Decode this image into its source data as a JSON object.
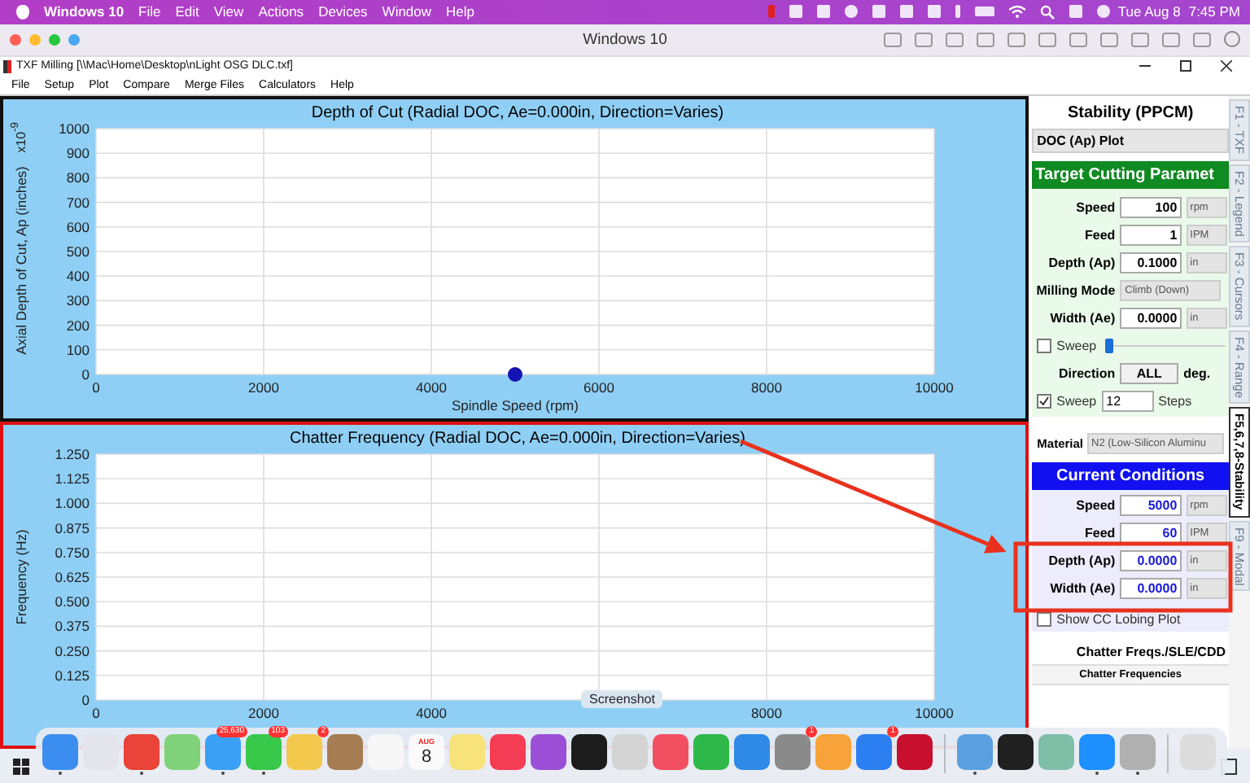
{
  "mac_menubar": {
    "app": "Windows 10",
    "menus": [
      "File",
      "Edit",
      "View",
      "Actions",
      "Devices",
      "Window",
      "Help"
    ],
    "date": "Tue Aug 8",
    "time": "7:45 PM"
  },
  "vm_window": {
    "title": "Windows 10"
  },
  "app_window": {
    "title": "TXF Milling [\\\\Mac\\Home\\Desktop\\nLight OSG DLC.txf]",
    "menus": [
      "File",
      "Setup",
      "Plot",
      "Compare",
      "Merge Files",
      "Calculators",
      "Help"
    ]
  },
  "plots": [
    {
      "selected": false,
      "scale_label": "x10$^{-9}$",
      "chart_data": {
        "grid": true,
        "type": "scatter",
        "title": "Depth of Cut (Radial DOC, Ae=0.000in, Direction=Varies)",
        "xlabel": "Spindle Speed (rpm)",
        "ylabel": "Axial Depth of Cut, Ap (inches)",
        "x": [
          5000
        ],
        "values": [
          0
        ],
        "xlim": [
          0,
          10000
        ],
        "ylim": [
          0,
          1000
        ],
        "xticks": [
          0,
          2000,
          4000,
          6000,
          8000,
          10000
        ],
        "yticks": [
          0,
          100,
          200,
          300,
          400,
          500,
          600,
          700,
          800,
          900,
          1000
        ]
      }
    },
    {
      "selected": true,
      "chart_data": {
        "grid": true,
        "type": "line",
        "title": "Chatter Frequency (Radial DOC, Ae=0.000in, Direction=Varies)",
        "ylabel": "Frequency (Hz)",
        "xlim": [
          0,
          10000
        ],
        "ylim": [
          0,
          1.25
        ],
        "xticks": [
          0,
          2000,
          4000,
          8000,
          10000
        ],
        "yticks": [
          {
            "value": 0,
            "label": "0"
          },
          {
            "value": 0.125,
            "label": "0.125"
          },
          {
            "value": 0.25,
            "label": "0.250"
          },
          {
            "value": 0.375,
            "label": "0.375"
          },
          {
            "value": 0.5,
            "label": "0.500"
          },
          {
            "value": 0.625,
            "label": "0.625"
          },
          {
            "value": 0.75,
            "label": "0.750"
          },
          {
            "value": 0.875,
            "label": "0.875"
          },
          {
            "value": 1,
            "label": "1.000"
          },
          {
            "value": 1.125,
            "label": "1.125"
          },
          {
            "value": 1.25,
            "label": "1.250"
          }
        ]
      }
    }
  ],
  "panel": {
    "title": "Stability (PPCM)",
    "plot_select": "DOC (Ap) Plot",
    "target": {
      "header": "Target Cutting Paramet",
      "rows": [
        {
          "kind": "field",
          "label": "Speed",
          "value": "100",
          "unit": "rpm"
        },
        {
          "kind": "field",
          "label": "Feed",
          "value": "1",
          "unit": "IPM"
        },
        {
          "kind": "field",
          "label": "Depth (Ap)",
          "value": "0.1000",
          "unit": "in"
        },
        {
          "kind": "select",
          "label": "Milling Mode",
          "value": "Climb (Down)"
        },
        {
          "kind": "field",
          "label": "Width (Ae)",
          "value": "0.0000",
          "unit": "in"
        },
        {
          "kind": "slider",
          "label": "Sweep",
          "checked": false,
          "level": 0
        },
        {
          "kind": "button",
          "label": "Direction",
          "value": "ALL",
          "unit": "deg."
        },
        {
          "kind": "steps",
          "label": "Sweep",
          "checked": true,
          "value": "12",
          "unit": "Steps"
        }
      ]
    },
    "material": {
      "label": "Material",
      "value": "N2 (Low-Silicon Aluminu"
    },
    "current": {
      "header": "Current Conditions",
      "rows": [
        {
          "kind": "field",
          "label": "Speed",
          "value": "5000",
          "unit": "rpm"
        },
        {
          "kind": "field",
          "label": "Feed",
          "value": "60",
          "unit": "IPM"
        },
        {
          "kind": "field",
          "label": "Depth (Ap)",
          "value": "0.0000",
          "unit": "in"
        },
        {
          "kind": "field",
          "label": "Width (Ae)",
          "value": "0.0000",
          "unit": "in"
        }
      ],
      "lobing": {
        "label": "Show CC Lobing Plot",
        "checked": false
      }
    },
    "chatter": {
      "title": "Chatter Freqs./SLE/CDD",
      "column": "Chatter Frequencies"
    }
  },
  "side_tabs": [
    {
      "label": "F1 - TXF",
      "selected": false
    },
    {
      "label": "F2 - Legend",
      "selected": false
    },
    {
      "label": "F3 - Cursors",
      "selected": false
    },
    {
      "label": "F4 - Range",
      "selected": false
    },
    {
      "label": "F5,6,7,8-Stability",
      "selected": true
    },
    {
      "label": "F9 - Modal",
      "selected": false
    }
  ],
  "tooltip": "Screenshot",
  "dock": {
    "groups": [
      [
        {
          "color": "#3b8ef0",
          "running": true
        },
        {
          "color": "#e4e4ec",
          "running": false
        },
        {
          "color": "#e9433a",
          "running": true
        },
        {
          "color": "#7fd27a",
          "running": false
        },
        {
          "color": "#3aa0f5",
          "running": true,
          "badge": "25,630"
        },
        {
          "color": "#38c84a",
          "running": true,
          "badge": "103"
        },
        {
          "color": "#f2c94c",
          "running": false,
          "badge": "2"
        },
        {
          "color": "#a67c52",
          "running": false
        },
        {
          "color": "#f7f7f7",
          "running": false
        },
        {
          "color": "#fafafa",
          "running": false,
          "month": "AUG",
          "day": "8"
        },
        {
          "color": "#f8e27a",
          "running": false
        },
        {
          "color": "#f43c54",
          "running": false
        },
        {
          "color": "#9a4fd6",
          "running": false
        },
        {
          "color": "#1c1c1c",
          "running": false
        },
        {
          "color": "#d4d4d4",
          "running": false
        },
        {
          "color": "#f25060",
          "running": false
        },
        {
          "color": "#2fb84a",
          "running": false
        },
        {
          "color": "#2e8ae6",
          "running": false
        },
        {
          "color": "#8a8a8a",
          "running": false,
          "badge": "1"
        },
        {
          "color": "#f7a33a",
          "running": false
        },
        {
          "color": "#2b7ff0",
          "running": false,
          "badge": "1"
        },
        {
          "color": "#c8102e",
          "running": false
        }
      ],
      [
        {
          "color": "#5aa0e0",
          "running": true
        },
        {
          "color": "#202020",
          "running": false
        },
        {
          "color": "#7fbfa8",
          "running": false
        },
        {
          "color": "#1e90ff",
          "running": true
        },
        {
          "color": "#b0b0b0",
          "running": true
        }
      ],
      [
        {
          "color": "#dcdcdc",
          "running": false
        }
      ]
    ]
  }
}
